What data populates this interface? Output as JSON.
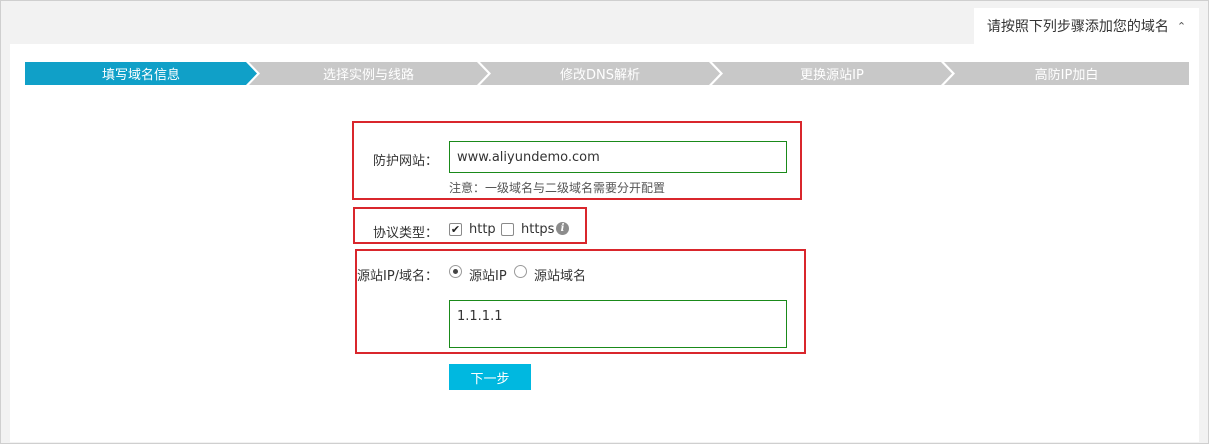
{
  "guide": {
    "title": "请按照下列步骤添加您的域名",
    "chevron_icon": "chevron-up-icon"
  },
  "steps": [
    {
      "label": "填写域名信息",
      "state": "active"
    },
    {
      "label": "选择实例与线路",
      "state": "todo"
    },
    {
      "label": "修改DNS解析",
      "state": "todo"
    },
    {
      "label": "更换源站IP",
      "state": "todo"
    },
    {
      "label": "高防IP加白",
      "state": "todo"
    }
  ],
  "colors": {
    "step_active": "#10a0c8",
    "step_todo": "#c8c8c8",
    "highlight_border": "#d9262c",
    "input_border": "#1a8a1a",
    "next_button": "#00b8e0"
  },
  "form": {
    "site": {
      "label": "防护网站：",
      "value": "www.aliyundemo.com",
      "hint": "注意：一级域名与二级域名需要分开配置"
    },
    "protocol": {
      "label": "协议类型：",
      "options": [
        {
          "label": "http",
          "checked": true
        },
        {
          "label": "https",
          "checked": false
        }
      ],
      "info_icon": "info-icon"
    },
    "origin": {
      "label": "源站IP/域名：",
      "options": [
        {
          "label": "源站IP",
          "selected": true
        },
        {
          "label": "源站域名",
          "selected": false
        }
      ],
      "value": "1.1.1.1"
    },
    "next_label": "下一步"
  }
}
